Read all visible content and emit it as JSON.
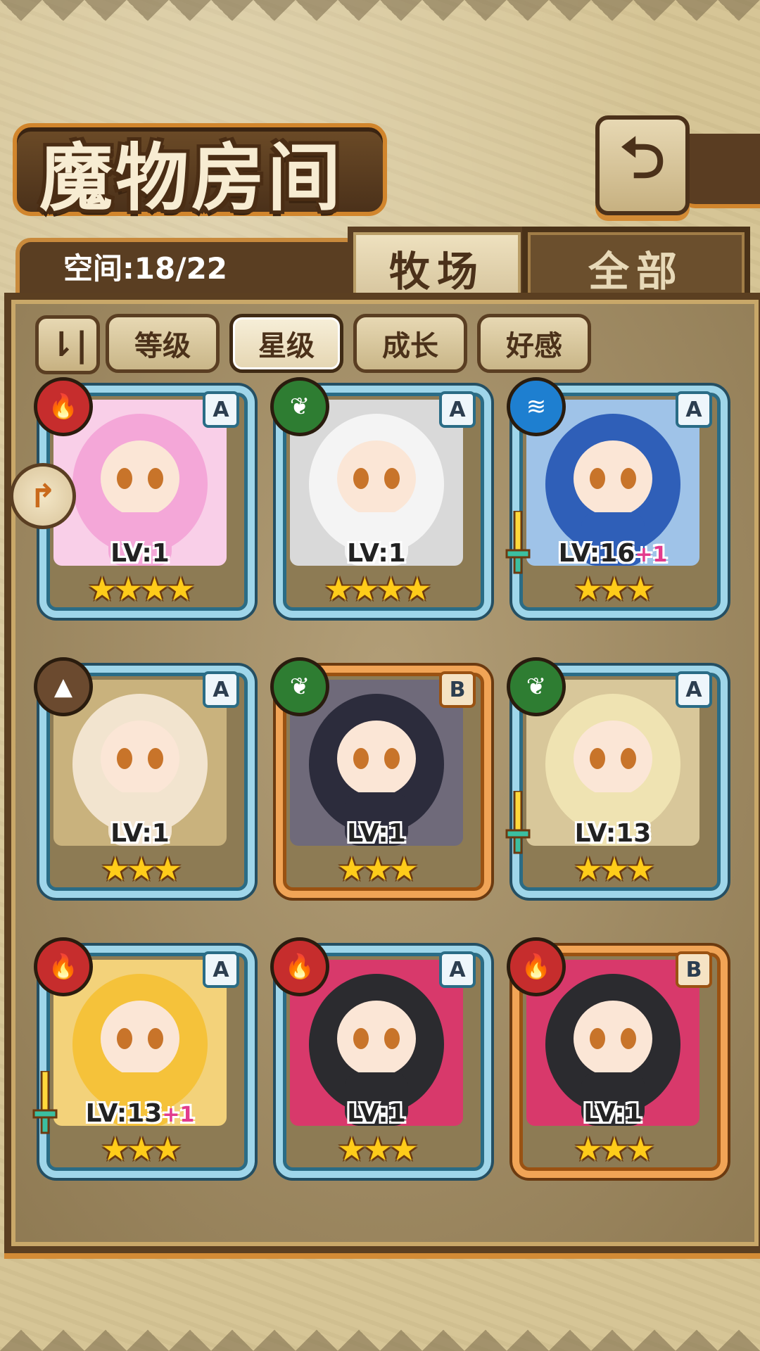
{
  "header": {
    "title": "魔物房间",
    "back_glyph": "⮌"
  },
  "space": {
    "label": "空间:18/22"
  },
  "tabs": {
    "active": "牧场",
    "inactive": "全部"
  },
  "filters": {
    "sort_glyph": "⇂|",
    "items": [
      {
        "label": "等级",
        "selected": false
      },
      {
        "label": "星级",
        "selected": true
      },
      {
        "label": "成长",
        "selected": false
      },
      {
        "label": "好感",
        "selected": false
      }
    ]
  },
  "side_button": {
    "glyph": "↱"
  },
  "monsters": [
    {
      "element": "fire",
      "element_glyph": "🔥",
      "rank": "A",
      "level": "LV:1",
      "bonus": "",
      "stars": "★★★★",
      "frame": "blue",
      "has_sword": false,
      "hair": "#f4a7d8",
      "bg": "#f9cfe8"
    },
    {
      "element": "leaf",
      "element_glyph": "❦",
      "rank": "A",
      "level": "LV:1",
      "bonus": "",
      "stars": "★★★★",
      "frame": "blue",
      "has_sword": false,
      "hair": "#f4f4f4",
      "bg": "#d9d9d9"
    },
    {
      "element": "water",
      "element_glyph": "≋",
      "rank": "A",
      "level": "LV:16",
      "bonus": "+1",
      "stars": "★★★",
      "frame": "blue",
      "has_sword": true,
      "hair": "#2f5fb8",
      "bg": "#9fc3e8"
    },
    {
      "element": "earth",
      "element_glyph": "▲",
      "rank": "A",
      "level": "LV:1",
      "bonus": "",
      "stars": "★★★",
      "frame": "blue",
      "has_sword": false,
      "hair": "#f2e4cf",
      "bg": "#c9b27d"
    },
    {
      "element": "leaf",
      "element_glyph": "❦",
      "rank": "B",
      "level": "LV:1",
      "bonus": "",
      "stars": "★★★",
      "frame": "orange",
      "has_sword": false,
      "hair": "#2c2c3c",
      "bg": "#6f6a7a"
    },
    {
      "element": "leaf",
      "element_glyph": "❦",
      "rank": "A",
      "level": "LV:13",
      "bonus": "",
      "stars": "★★★",
      "frame": "blue",
      "has_sword": true,
      "hair": "#efe3b2",
      "bg": "#d8c79a"
    },
    {
      "element": "fire",
      "element_glyph": "🔥",
      "rank": "A",
      "level": "LV:13",
      "bonus": "+1",
      "stars": "★★★",
      "frame": "blue",
      "has_sword": true,
      "hair": "#f5c23a",
      "bg": "#f3d27a"
    },
    {
      "element": "fire",
      "element_glyph": "🔥",
      "rank": "A",
      "level": "LV:1",
      "bonus": "",
      "stars": "★★★",
      "frame": "blue",
      "has_sword": false,
      "hair": "#2b2b2f",
      "bg": "#d8396b"
    },
    {
      "element": "fire",
      "element_glyph": "🔥",
      "rank": "B",
      "level": "LV:1",
      "bonus": "",
      "stars": "★★★",
      "frame": "orange",
      "has_sword": false,
      "hair": "#2b2b2f",
      "bg": "#d8396b"
    }
  ],
  "colors": {
    "fire": "#c62d2d",
    "leaf": "#2e7d32",
    "water": "#1e7fd0",
    "earth": "#6b4a2f"
  }
}
